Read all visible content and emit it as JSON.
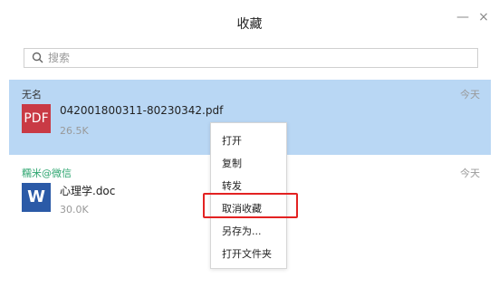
{
  "window": {
    "title": "收藏",
    "minimize_icon": "minimize-icon",
    "close_icon": "close-icon"
  },
  "search": {
    "placeholder": "搜索",
    "value": "",
    "icon": "search-icon"
  },
  "favorites": [
    {
      "source": "无名",
      "date": "今天",
      "file_type": "PDF",
      "file_name": "042001800311-80230342.pdf",
      "file_size": "26.5K",
      "selected": true
    },
    {
      "source": "糯米@微信",
      "date": "今天",
      "file_type": "W",
      "file_name": "心理学.doc",
      "file_size": "30.0K",
      "selected": false
    }
  ],
  "context_menu": {
    "items": [
      "打开",
      "复制",
      "转发",
      "取消收藏",
      "另存为...",
      "打开文件夹"
    ],
    "highlighted_item": "取消收藏",
    "highlight_color": "#e32222"
  },
  "colors": {
    "selected_background": "#b9d7f4",
    "pdf_icon": "#c93a45",
    "word_icon": "#2b5aa7",
    "source_green": "#2ca56f"
  }
}
